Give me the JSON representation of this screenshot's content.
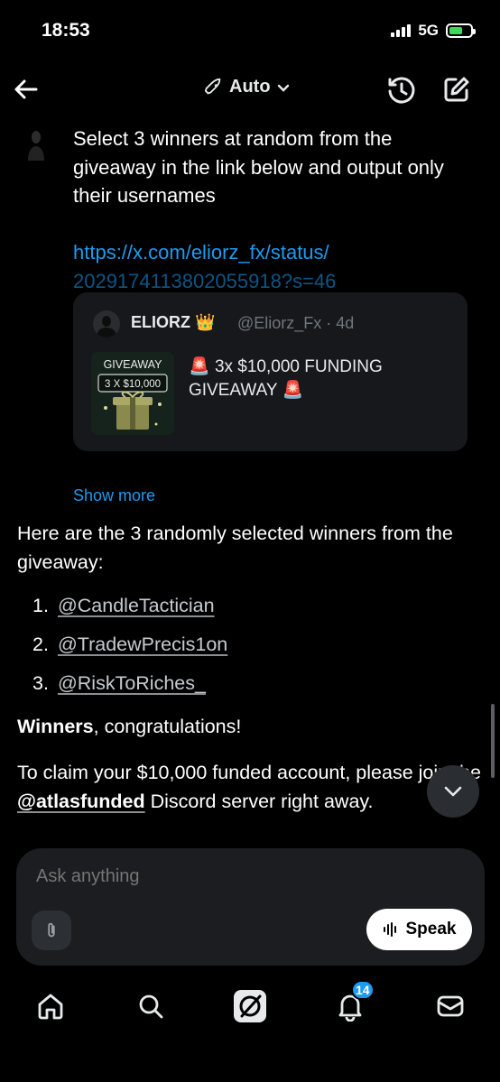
{
  "status_bar": {
    "time": "18:53",
    "network": "5G"
  },
  "header": {
    "mode_label": "Auto"
  },
  "prompt": {
    "text": "Select 3 winners at random from the giveaway in the link below and output only their usernames",
    "link_line1": "https://x.com/eliorz_fx/status/",
    "link_line2": "2029174113802055918?s=46"
  },
  "quote": {
    "name": "ELIORZ",
    "handle": "@Eliorz_Fx · 4d",
    "text": "3x $10,000 FUNDING GIVEAWAY",
    "media_label_top": "GIVEAWAY",
    "media_label_amount": "3 X $10,000"
  },
  "show_more": "Show more",
  "response": {
    "intro": "Here are the 3 randomly selected winners from the giveaway:",
    "winners": [
      {
        "num": "1.",
        "name": "@CandleTactician"
      },
      {
        "num": "2.",
        "name": "@TradewPrecis1on"
      },
      {
        "num": "3.",
        "name": "@RiskToRiches_"
      }
    ],
    "congrats_bold": "Winners",
    "congrats_rest": ", congratulations!",
    "claim_before": "To claim your $10,000 funded account, please join the ",
    "claim_mention": "@atlasfunded",
    "claim_after": "  Discord server right away."
  },
  "composer": {
    "placeholder": "Ask anything",
    "speak_label": "Speak"
  },
  "nav": {
    "notifications_badge": "14"
  },
  "colors": {
    "link": "#1d9bf0",
    "background": "#000000",
    "card": "#16181c"
  }
}
